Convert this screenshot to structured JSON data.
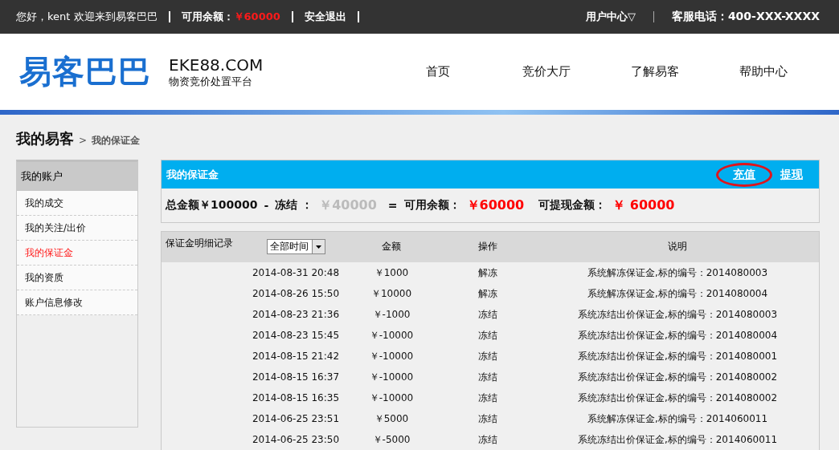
{
  "top_bar": {
    "greeting": "您好，kent 欢迎来到易客巴巴",
    "balance_label": "可用余额：",
    "balance_value": "￥60000",
    "logout": "安全退出",
    "user_center": "用户中心▽",
    "hotline": "客服电话：400-XXX-XXXX"
  },
  "header": {
    "logo": "易客巴巴",
    "domain": "EKE88.COM",
    "slogan": "物资竞价处置平台",
    "nav": [
      {
        "label": "首页"
      },
      {
        "label": "竞价大厅"
      },
      {
        "label": "了解易客"
      },
      {
        "label": "帮助中心"
      }
    ]
  },
  "breadcrumb": {
    "root": "我的易客",
    "separator": ">",
    "current": "我的保证金"
  },
  "sidebar": {
    "title": "我的账户",
    "items": [
      {
        "label": "我的成交",
        "selected": false
      },
      {
        "label": "我的关注/出价",
        "selected": false
      },
      {
        "label": "我的保证金",
        "selected": true
      },
      {
        "label": "我的资质",
        "selected": false
      },
      {
        "label": "账户信息修改",
        "selected": false
      }
    ]
  },
  "deposit": {
    "title": "我的保证金",
    "actions": [
      {
        "label": "充值",
        "highlighted": true
      },
      {
        "label": "提现",
        "highlighted": false
      }
    ],
    "summary": {
      "total_label": "总金额",
      "total_value": "￥100000",
      "minus": "-",
      "frozen_label": "冻结 ：",
      "frozen_value": "￥40000",
      "equals": "=",
      "available_label": "可用余额：",
      "available_value": "￥60000",
      "withdrawable_label": "可提现金额：",
      "withdrawable_value": "￥ 60000"
    }
  },
  "records": {
    "title": "保证金明细记录",
    "filter": "全部时间",
    "columns": [
      "金额",
      "操作",
      "说明"
    ],
    "rows": [
      {
        "time": "2014-08-31 20:48",
        "amount": "￥1000",
        "action": "解冻",
        "note": "系统解冻保证金,标的编号：2014080003"
      },
      {
        "time": "2014-08-26 15:50",
        "amount": "￥10000",
        "action": "解冻",
        "note": "系统解冻保证金,标的编号：2014080004"
      },
      {
        "time": "2014-08-23 21:36",
        "amount": "￥-1000",
        "action": "冻结",
        "note": "系统冻结出价保证金,标的编号：2014080003"
      },
      {
        "time": "2014-08-23 15:45",
        "amount": "￥-10000",
        "action": "冻结",
        "note": "系统冻结出价保证金,标的编号：2014080004"
      },
      {
        "time": "2014-08-15 21:42",
        "amount": "￥-10000",
        "action": "冻结",
        "note": "系统冻结出价保证金,标的编号：2014080001"
      },
      {
        "time": "2014-08-15 16:37",
        "amount": "￥-10000",
        "action": "冻结",
        "note": "系统冻结出价保证金,标的编号：2014080002"
      },
      {
        "time": "2014-08-15 16:35",
        "amount": "￥-10000",
        "action": "冻结",
        "note": "系统冻结出价保证金,标的编号：2014080002"
      },
      {
        "time": "2014-06-25 23:51",
        "amount": "￥5000",
        "action": "冻结",
        "note": "系统解冻保证金,标的编号：2014060011"
      },
      {
        "time": "2014-06-25 23:50",
        "amount": "￥-5000",
        "action": "冻结",
        "note": "系统冻结出价保证金,标的编号：2014060011"
      }
    ]
  }
}
